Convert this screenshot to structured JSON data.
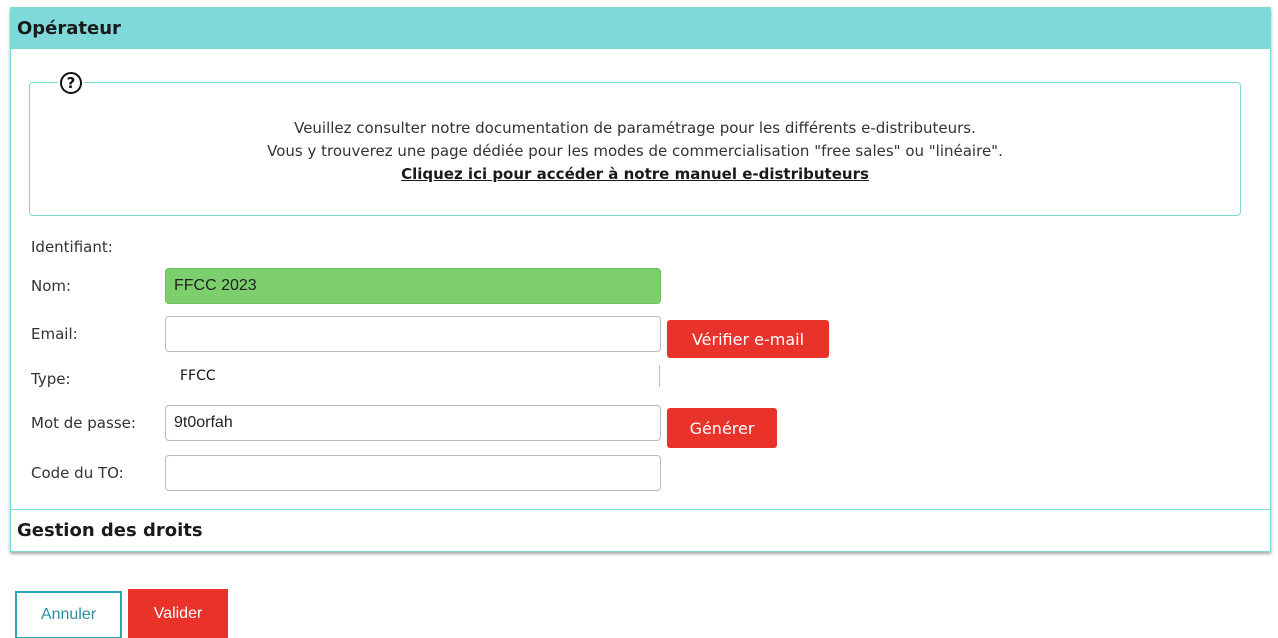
{
  "panel": {
    "title": "Opérateur",
    "info": {
      "icon": "help-circle-icon",
      "line1": "Veuillez consulter notre documentation de paramétrage pour les différents e-distributeurs.",
      "line2": "Vous y trouverez une page dédiée pour les modes de commercialisation \"free sales\" ou \"linéaire\".",
      "link": "Cliquez ici pour accéder à notre manuel e-distributeurs"
    },
    "form": {
      "identifiant_label": "Identifiant:",
      "nom_label": "Nom:",
      "nom_value": "FFCC 2023",
      "email_label": "Email:",
      "email_value": "",
      "verify_email_button": "Vérifier e-mail",
      "type_label": "Type:",
      "type_value": "FFCC",
      "password_label": "Mot de passe:",
      "password_value": "9t0orfah",
      "generate_button": "Générer",
      "code_to_label": "Code du TO:",
      "code_to_value": ""
    },
    "rights_section_title": "Gestion des droits"
  },
  "actions": {
    "cancel": "Annuler",
    "submit": "Valider"
  },
  "colors": {
    "accent": "#7fd8da",
    "danger": "#e8322a",
    "success_field": "#7ccf6c",
    "cancel_border": "#2aa7b5"
  }
}
